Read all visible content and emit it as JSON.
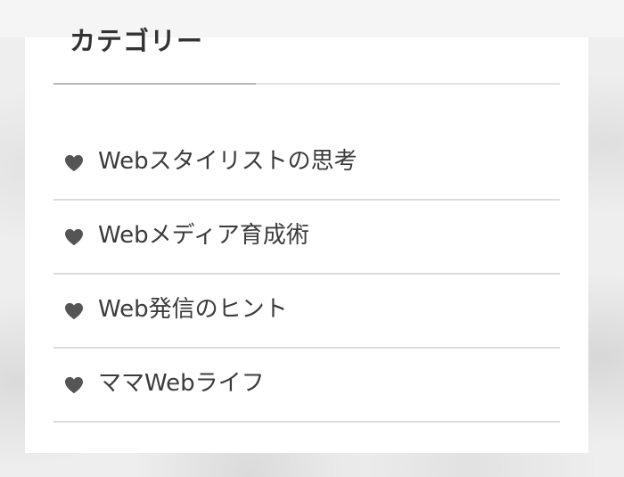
{
  "widget": {
    "title": "カテゴリー",
    "icon": "heart-icon",
    "icon_color": "#555555",
    "text_color": "#3b3b3b",
    "items": [
      {
        "label": "Webスタイリストの思考"
      },
      {
        "label": "Webメディア育成術"
      },
      {
        "label": "Web発信のヒント"
      },
      {
        "label": "ママWebライフ"
      }
    ]
  }
}
